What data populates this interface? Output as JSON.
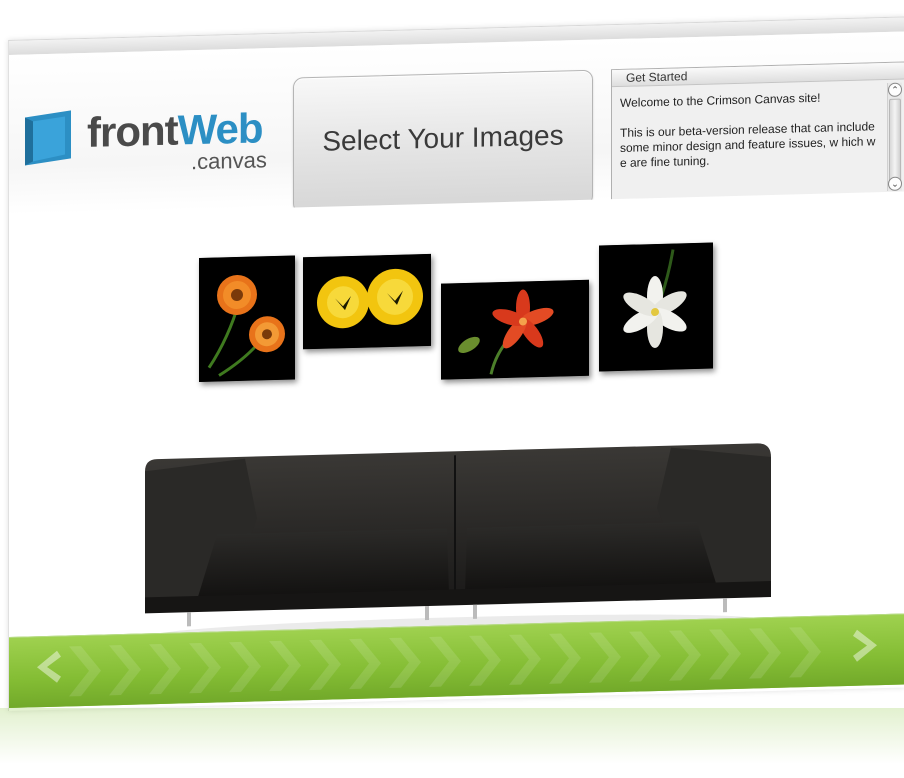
{
  "brand": {
    "logo_main_a": "front",
    "logo_main_b": "Web",
    "logo_sub": ".canvas",
    "color_blue": "#2c8fc4",
    "color_grey": "#4a4a4a"
  },
  "header": {
    "select_button_label": "Select Your Images"
  },
  "get_started": {
    "title": "Get Started",
    "paragraph_1": "Welcome to the Crimson Canvas site!",
    "paragraph_2": "This is our beta-version release that can include some minor design and feature issues, w hich w e are fine tuning."
  },
  "gallery": {
    "frames": [
      {
        "subject": "orange-gerbera-daisies"
      },
      {
        "subject": "yellow-poppies"
      },
      {
        "subject": "red-lily"
      },
      {
        "subject": "white-lily"
      }
    ]
  },
  "footer": {
    "accent_color": "#8cc63f",
    "left_arrow_icon": "chevron-left-icon",
    "right_arrow_icon": "chevron-right-icon"
  }
}
